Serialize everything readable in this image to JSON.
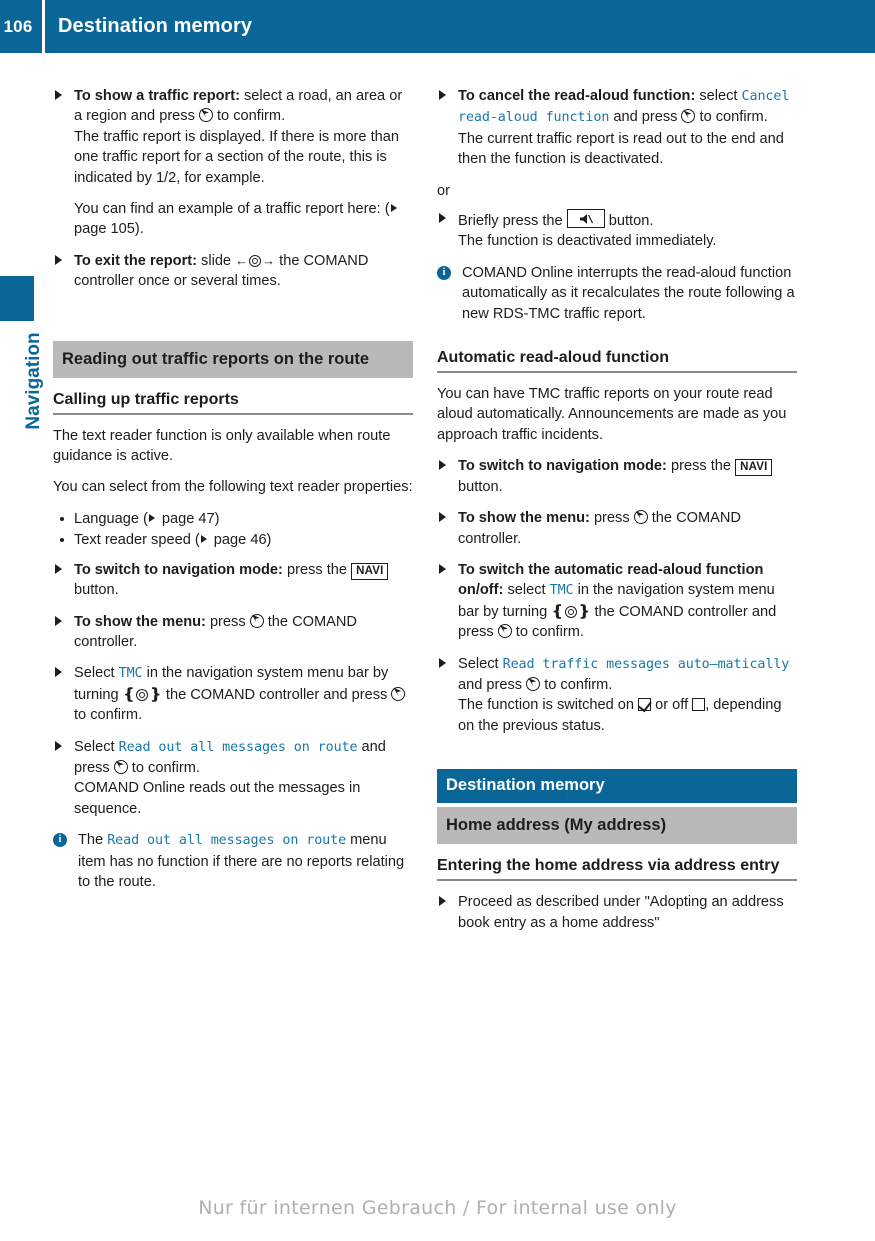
{
  "header": {
    "page_number": "106",
    "title": "Destination memory"
  },
  "sidebar": {
    "chapter_label": "Navigation"
  },
  "footer": {
    "watermark": "Nur für internen Gebrauch / For internal use only"
  },
  "icons": {
    "press_controller": "press-controller-icon",
    "turn_controller": "turn-controller-icon",
    "slide_controller": "slide-controller-icon",
    "navi_key": "NAVI",
    "mute_key": "mute-button-icon",
    "info": "i",
    "checkbox_on": "checkbox-checked-icon",
    "checkbox_off": "checkbox-unchecked-icon",
    "cross_reference": "page-reference-icon"
  },
  "colors": {
    "brand_blue": "#0b6698",
    "menu_blue": "#1978a8",
    "heading_gray": "#b9b9b9"
  },
  "left_column": {
    "b1": {
      "lead": "To show a traffic report:",
      "t1": " select a road, an area or a region and press ",
      "t2": " to confirm.",
      "p2": "The traffic report is displayed. If there is more than one traffic report for a section of the route, this is indicated by 1/2, for example.",
      "p3a": "You can find an example of a traffic report here: (",
      "p3b": " page 105)."
    },
    "b2": {
      "lead": "To exit the report:",
      "t1": " slide ",
      "t2": " the COMAND controller once or several times."
    },
    "section_bar": "Reading out traffic reports on the route",
    "subheading": "Calling up traffic reports",
    "p_avail": "The text reader function is only available when route guidance is active.",
    "p_select": "You can select from the following text reader properties:",
    "bullets": [
      {
        "a": "Language (",
        "b": " page 47)"
      },
      {
        "a": "Text reader speed (",
        "b": " page 46)"
      }
    ],
    "b3": {
      "lead": "To switch to navigation mode:",
      "t1": " press the ",
      "t2": " button."
    },
    "b4": {
      "lead": "To show the menu:",
      "t1": " press ",
      "t2": " the COMAND controller."
    },
    "b5": {
      "t1": "Select ",
      "menu": "TMC",
      "t2": " in the navigation system menu bar by turning ",
      "t3": " the COMAND controller and press ",
      "t4": " to confirm."
    },
    "b6": {
      "t1": "Select ",
      "menu": "Read out all messages on route",
      "t2": " and press ",
      "t3": " to confirm.",
      "p2": "COMAND Online reads out the messages in sequence."
    },
    "note1": {
      "t1": "The ",
      "menu": "Read out all messages on route",
      "t2": " menu item has no function if there are no reports relating to the route."
    }
  },
  "right_column": {
    "b1": {
      "lead": "To cancel the read-aloud function:",
      "t1": " select ",
      "menu": "Cancel read-aloud function",
      "t2": " and press ",
      "t3": " to confirm.",
      "p2": "The current traffic report is read out to the end and then the function is deactivated."
    },
    "or": "or",
    "b2": {
      "t1": "Briefly press the ",
      "t2": " button.",
      "p2": "The function is deactivated immediately."
    },
    "note1": "COMAND Online interrupts the read-aloud function automatically as it recalculates the route following a new RDS-TMC traffic report.",
    "subheading": "Automatic read-aloud function",
    "p_intro": "You can have TMC traffic reports on your route read aloud automatically. Announcements are made as you approach traffic incidents.",
    "b3": {
      "lead": "To switch to navigation mode:",
      "t1": " press the ",
      "t2": " button."
    },
    "b4": {
      "lead": "To show the menu:",
      "t1": " press ",
      "t2": " the COMAND controller."
    },
    "b5": {
      "lead": "To switch the automatic read-aloud function on/off:",
      "t1": " select ",
      "menu": "TMC",
      "t2": " in the navigation system menu bar by turning ",
      "t3": " the COMAND controller and press ",
      "t4": " to confirm."
    },
    "b6": {
      "t1": "Select ",
      "menu": "Read traffic messages auto–matically",
      "t2": " and press ",
      "t3": " to confirm.",
      "p2a": "The function is switched on ",
      "p2b": " or off ",
      "p2c": ", depending on the previous status."
    },
    "chapter_bar": "Destination memory",
    "section_bar": "Home address (My address)",
    "subheading2": "Entering the home address via address entry",
    "b7": "Proceed as described under \"Adopting an address book entry as a home address\""
  }
}
